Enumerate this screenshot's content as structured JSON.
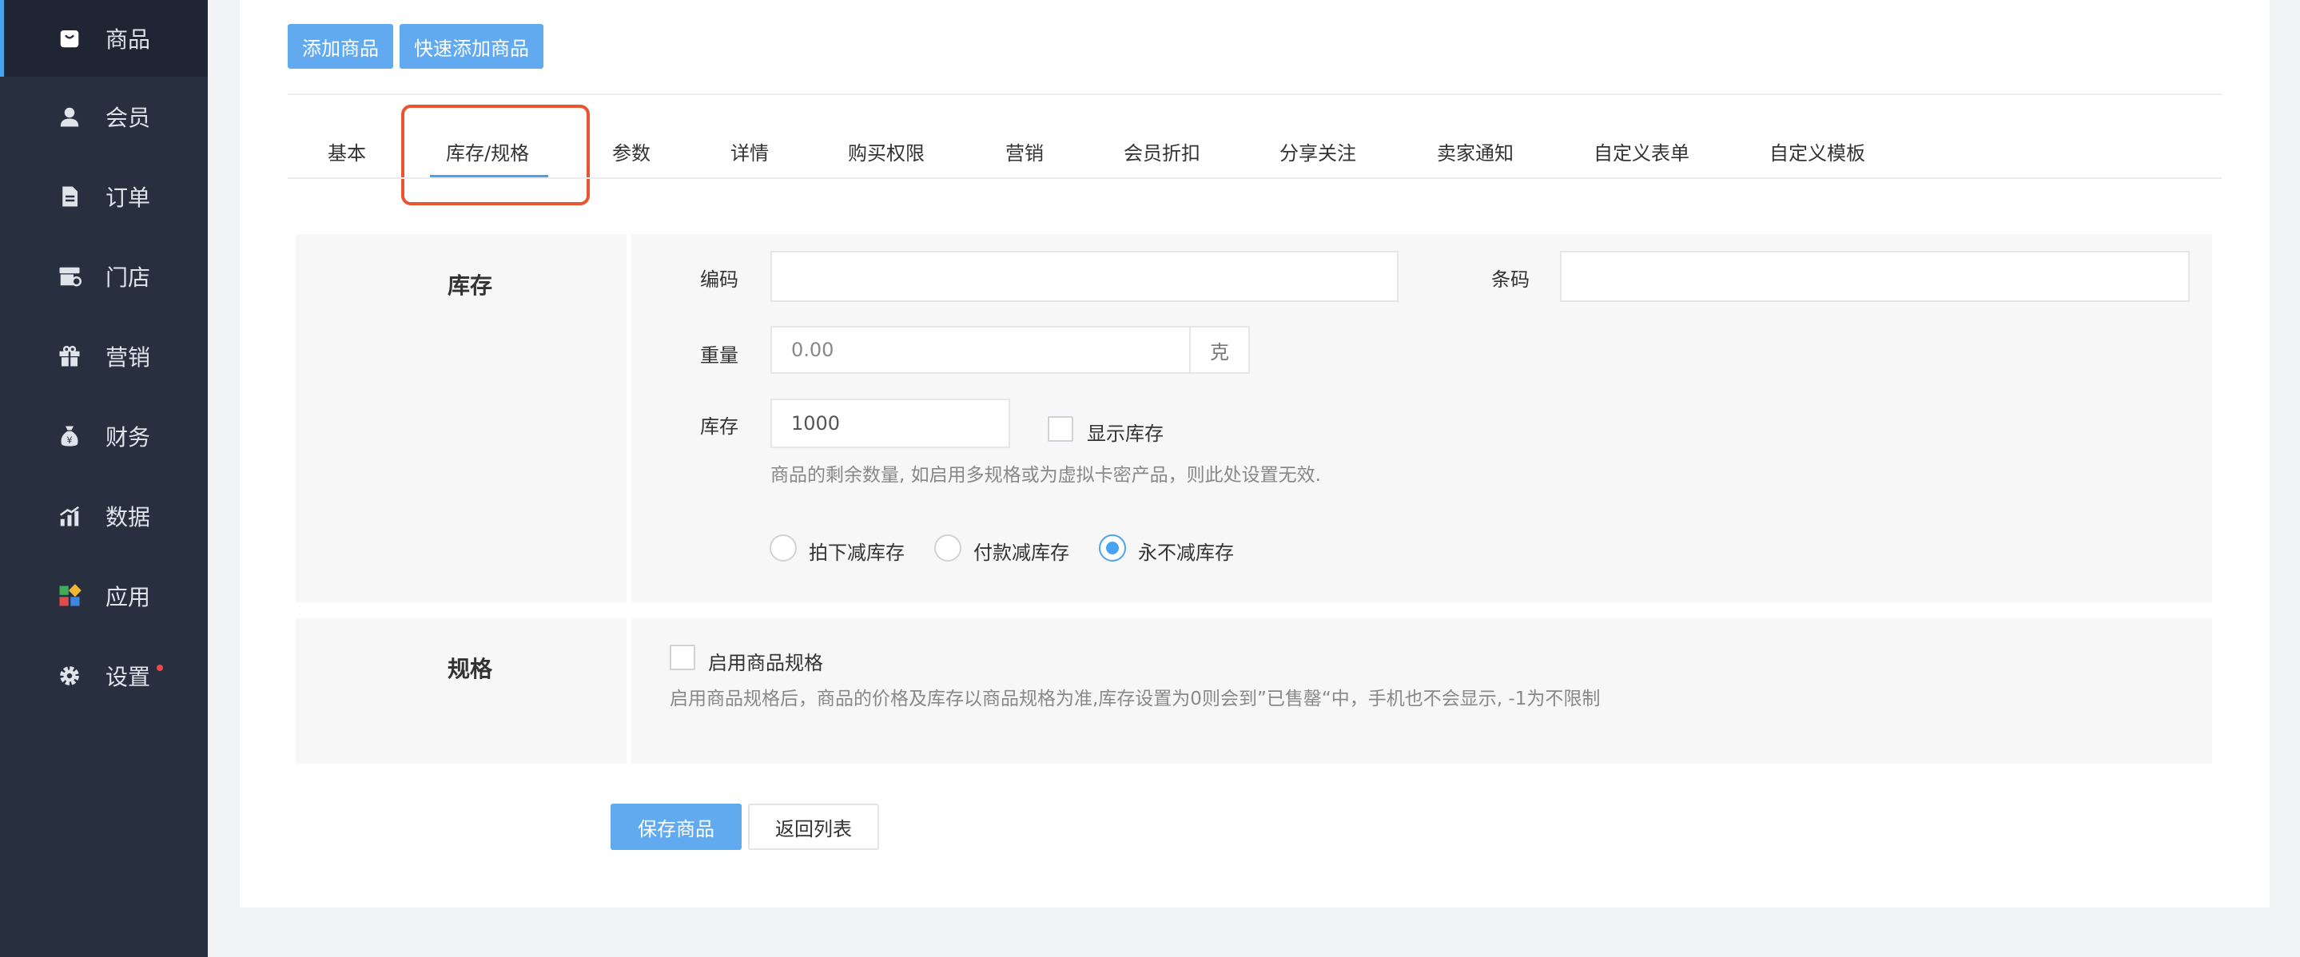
{
  "sidebar": {
    "items": [
      {
        "label": "商品",
        "icon": "shopping-bag-icon"
      },
      {
        "label": "会员",
        "icon": "user-icon"
      },
      {
        "label": "订单",
        "icon": "document-icon"
      },
      {
        "label": "门店",
        "icon": "store-icon"
      },
      {
        "label": "营销",
        "icon": "gift-icon"
      },
      {
        "label": "财务",
        "icon": "money-bag-icon"
      },
      {
        "label": "数据",
        "icon": "bar-chart-icon"
      },
      {
        "label": "应用",
        "icon": "apps-icon"
      },
      {
        "label": "设置",
        "icon": "gear-icon"
      }
    ],
    "active_index": 0,
    "settings_badge_color": "#f04848"
  },
  "toolbar": {
    "add_product": "添加商品",
    "quick_add_product": "快速添加商品"
  },
  "tabs": [
    "基本",
    "库存/规格",
    "参数",
    "详情",
    "购买权限",
    "营销",
    "会员折扣",
    "分享关注",
    "卖家通知",
    "自定义表单",
    "自定义模板"
  ],
  "active_tab": "库存/规格",
  "inventory": {
    "title": "库存",
    "code_label": "编码",
    "code_value": "",
    "barcode_label": "条码",
    "barcode_value": "",
    "weight_label": "重量",
    "weight_placeholder": "0.00",
    "weight_unit": "克",
    "stock_label": "库存",
    "stock_value": "1000",
    "show_stock_label": "显示库存",
    "stock_hint": "商品的剩余数量, 如启用多规格或为虚拟卡密产品，则此处设置无效.",
    "deduct_options": [
      "拍下减库存",
      "付款减库存",
      "永不减库存"
    ],
    "deduct_selected": "永不减库存"
  },
  "spec": {
    "title": "规格",
    "enable_label": "启用商品规格",
    "hint": "启用商品规格后，商品的价格及库存以商品规格为准,库存设置为0则会到”已售罄“中，手机也不会显示, -1为不限制"
  },
  "footer": {
    "save": "保存商品",
    "back": "返回列表"
  },
  "colors": {
    "accent": "#4aa3f0",
    "button_blue": "#61aaf0",
    "sidebar_bg": "#283040",
    "highlight_red": "#e8552f"
  }
}
